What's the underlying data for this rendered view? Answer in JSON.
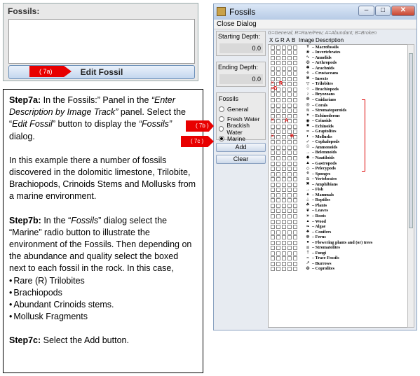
{
  "fossil_panel": {
    "legend": "Fossils:",
    "edit_button": "Edit Fossil",
    "arrow_label": "( 7a)"
  },
  "instructions": {
    "p1": {
      "b": "Step7a:",
      "t1": " In the Fossils:” Panel in the ",
      "i1": "“Enter Description by Image Track”",
      "t2": " panel.  Select the “",
      "i2": "Edit Fossil",
      "t3": "” button to display the ",
      "i3": "“Fossils”",
      "t4": " dialog."
    },
    "p2": "In this example there a number of fossils discovered in the dolomitic limestone, Trilobite, Brachiopods, Crinoids Stems and Mollusks from a marine environment.",
    "p3": {
      "b": "Step7b:",
      "t1": " In the “",
      "i1": "Fossils",
      "t2": "” dialog select the “Marine” radio button to illustrate the environment of the Fossils.  Then depending on the abundance and quality select the boxed next to each fossil in the rock.  In this case,"
    },
    "bullets": [
      "Rare (R) Trilobites",
      "Brachiopods",
      "Abundant Crinoids stems.",
      "Mollusk Fragments"
    ],
    "p4": {
      "b": "Step7c:",
      "t": " Select the Add button."
    }
  },
  "callouts": {
    "b": "( 7b )",
    "c": "( 7c )"
  },
  "dialog": {
    "title": "Fossils",
    "menu": "Close Dialog",
    "starting_depth": {
      "label": "Starting Depth:",
      "value": "0.0"
    },
    "ending_depth": {
      "label": "Ending Depth:",
      "value": "0.0"
    },
    "env_label": "Fossils",
    "environments": [
      "General",
      "Fresh Water",
      "Brackish Water",
      "Marine"
    ],
    "selected_environment": "Marine",
    "add_button": "Add",
    "clear_button": "Clear",
    "legend": "G=General; R=Rare/Few; A=Abundant; B=Broken",
    "headers": [
      "X",
      "G",
      "R",
      "A",
      "B",
      "Image",
      "Description"
    ],
    "fossils": [
      {
        "icon": "☤",
        "label": "– Macrofossils"
      },
      {
        "icon": "❀",
        "label": "– Invertebrates"
      },
      {
        "icon": "∿",
        "label": "– Annelids"
      },
      {
        "icon": "✠",
        "label": "– Arthropods"
      },
      {
        "icon": "✱",
        "label": "– Arachnids"
      },
      {
        "icon": "⚘",
        "label": "– Crustaceans"
      },
      {
        "icon": "❃",
        "label": "– Insects"
      },
      {
        "icon": "▽",
        "label": "– Trilobites",
        "marker": "R",
        "checked": [
          0
        ]
      },
      {
        "icon": "○",
        "label": "– Brachiopods",
        "marker": "G",
        "checked": [
          0
        ]
      },
      {
        "icon": "≀",
        "label": "– Bryozoans"
      },
      {
        "icon": "❁",
        "label": "– Cnidarians"
      },
      {
        "icon": "◎",
        "label": "– Corals"
      },
      {
        "icon": "≋",
        "label": "– Stromatoporoids"
      },
      {
        "icon": "✴",
        "label": "– Echinoderms"
      },
      {
        "icon": "◉",
        "label": "– Crinoids",
        "marker": "A",
        "checked": [
          0
        ]
      },
      {
        "icon": "✸",
        "label": "– Echinoids"
      },
      {
        "icon": "≂",
        "label": "– Graptolites"
      },
      {
        "icon": "◐",
        "label": "– Mollusks",
        "marker": "B",
        "checked": [
          0
        ]
      },
      {
        "icon": "✓",
        "label": "– Cephalopods"
      },
      {
        "icon": "☉",
        "label": "– Ammonoids"
      },
      {
        "icon": "→",
        "label": "– Belemnoids"
      },
      {
        "icon": "◆",
        "label": "– Nautiloids"
      },
      {
        "icon": "▲",
        "label": "– Gastropods"
      },
      {
        "icon": "◇",
        "label": "– Pelecypods"
      },
      {
        "icon": "⚘",
        "label": "– Sponges"
      },
      {
        "icon": "≊",
        "label": "– Vertebrates"
      },
      {
        "icon": "✖",
        "label": "– Amphibians"
      },
      {
        "icon": "→",
        "label": "– Fish"
      },
      {
        "icon": "♠",
        "label": "– Mammals"
      },
      {
        "icon": "♧",
        "label": "– Reptiles"
      },
      {
        "icon": "☘",
        "label": "– Plants"
      },
      {
        "icon": "❦",
        "label": "– Leaves"
      },
      {
        "icon": "☀",
        "label": "– Roots"
      },
      {
        "icon": "▴",
        "label": "– Wood"
      },
      {
        "icon": "❧",
        "label": "– Algae"
      },
      {
        "icon": "♣",
        "label": "– Conifers"
      },
      {
        "icon": "☸",
        "label": "– Ferns"
      },
      {
        "icon": "●",
        "label": "– Flowering plants and (or) trees"
      },
      {
        "icon": "≌",
        "label": "– Stromatolites"
      },
      {
        "icon": "†",
        "label": "– Fungi"
      },
      {
        "icon": "≈",
        "label": "– Trace Fossils"
      },
      {
        "icon": "↗",
        "label": "– Burrows"
      },
      {
        "icon": "❂",
        "label": "– Coprolites"
      }
    ]
  }
}
